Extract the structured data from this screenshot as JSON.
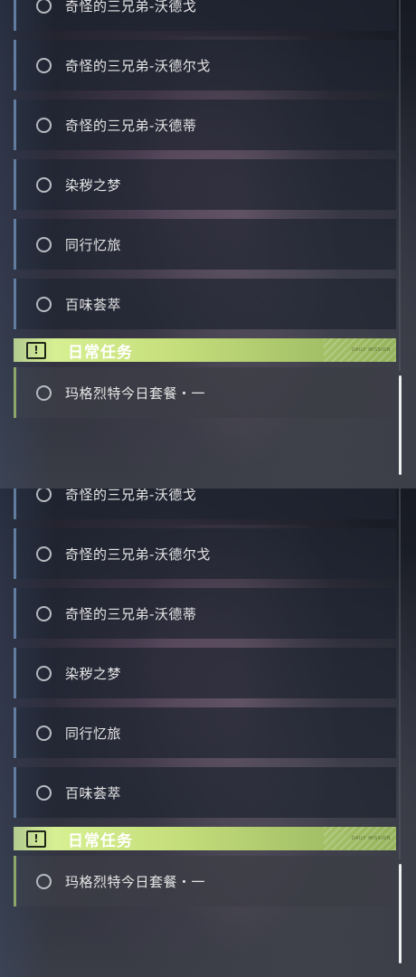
{
  "panels": [
    {
      "quests": [
        {
          "label": "奇怪的三兄弟-沃德戈"
        },
        {
          "label": "奇怪的三兄弟-沃德尔戈"
        },
        {
          "label": "奇怪的三兄弟-沃德蒂"
        },
        {
          "label": "染秽之梦"
        },
        {
          "label": "同行忆旅"
        },
        {
          "label": "百味荟萃"
        }
      ],
      "daily_section": {
        "title": "日常任务",
        "icon": "!",
        "deco_text": "DAILY MISSION",
        "items": [
          {
            "label": "玛格烈特今日套餐・一"
          }
        ]
      }
    },
    {
      "quests": [
        {
          "label": "奇怪的三兄弟-沃德戈"
        },
        {
          "label": "奇怪的三兄弟-沃德尔戈"
        },
        {
          "label": "奇怪的三兄弟-沃德蒂"
        },
        {
          "label": "染秽之梦"
        },
        {
          "label": "同行忆旅"
        },
        {
          "label": "百味荟萃"
        }
      ],
      "daily_section": {
        "title": "日常任务",
        "icon": "!",
        "deco_text": "DAILY MISSION",
        "items": [
          {
            "label": "玛格烈特今日套餐・一"
          }
        ]
      }
    }
  ],
  "colors": {
    "accent_green": "#c7e07d",
    "quest_border": "#6f8bb0",
    "text": "#e6e6e6"
  }
}
